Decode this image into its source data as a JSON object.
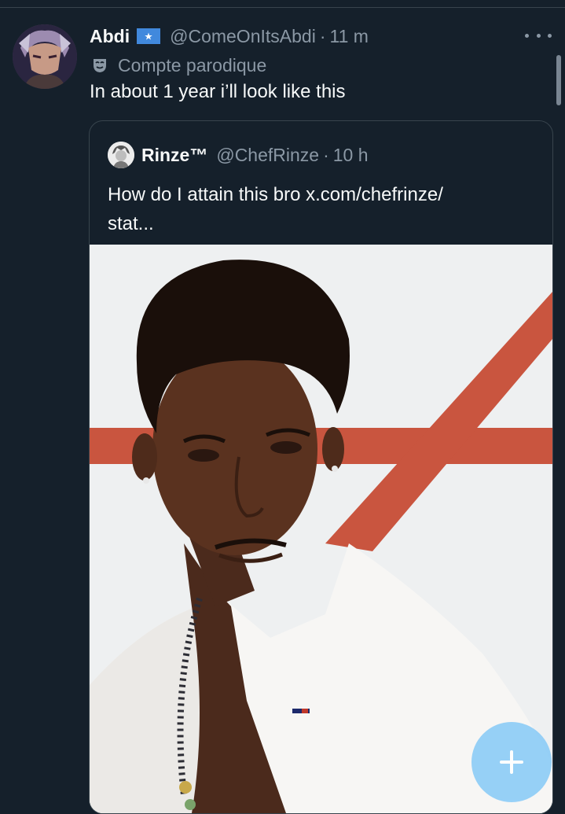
{
  "tweet": {
    "display_name": "Abdi",
    "flag_icon": "somalia-flag-icon",
    "handle": "@ComeOnItsAbdi",
    "separator": "·",
    "time": "11 m",
    "parody_icon": "mask-icon",
    "parody_label": "Compte parodique",
    "text": "In about 1 year i’ll look like this"
  },
  "quote": {
    "display_name": "Rinze™",
    "handle": "@ChefRinze",
    "separator": "·",
    "time": "10 h",
    "text": "How do I attain this bro x.com/chefrinze/\nstat..."
  },
  "actions": {
    "more_icon": "more-horizontal-icon",
    "compose_icon": "plus-icon"
  },
  "colors": {
    "background": "#15202b",
    "text_primary": "#f7f9f9",
    "text_secondary": "#8b98a5",
    "border": "#38444d",
    "fab": "#8ecdf7"
  }
}
